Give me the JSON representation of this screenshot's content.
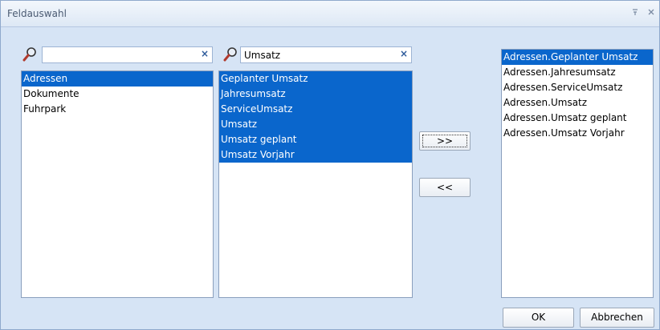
{
  "window": {
    "title": "Feldauswahl",
    "pin_icon": "pin-icon",
    "close_icon": "close-icon"
  },
  "left_panel": {
    "search": {
      "value": "",
      "clear": "×"
    },
    "items": [
      {
        "label": "Adressen",
        "selected": true
      },
      {
        "label": "Dokumente",
        "selected": false
      },
      {
        "label": "Fuhrpark",
        "selected": false
      }
    ]
  },
  "middle_panel": {
    "search": {
      "value": "Umsatz",
      "clear": "×"
    },
    "items": [
      {
        "label": "Geplanter Umsatz",
        "selected": true
      },
      {
        "label": "Jahresumsatz",
        "selected": true
      },
      {
        "label": "ServiceUmsatz",
        "selected": true
      },
      {
        "label": "Umsatz",
        "selected": true
      },
      {
        "label": "Umsatz geplant",
        "selected": true
      },
      {
        "label": "Umsatz Vorjahr",
        "selected": true
      }
    ]
  },
  "right_panel": {
    "items": [
      {
        "label": "Adressen.Geplanter Umsatz",
        "selected": true
      },
      {
        "label": "Adressen.Jahresumsatz",
        "selected": false
      },
      {
        "label": "Adressen.ServiceUmsatz",
        "selected": false
      },
      {
        "label": "Adressen.Umsatz",
        "selected": false
      },
      {
        "label": "Adressen.Umsatz geplant",
        "selected": false
      },
      {
        "label": "Adressen.Umsatz Vorjahr",
        "selected": false
      }
    ]
  },
  "buttons": {
    "add": ">>",
    "remove": "<<",
    "ok": "OK",
    "cancel": "Abbrechen"
  },
  "colors": {
    "selection": "#0a66cc",
    "window_bg": "#d6e4f5"
  }
}
